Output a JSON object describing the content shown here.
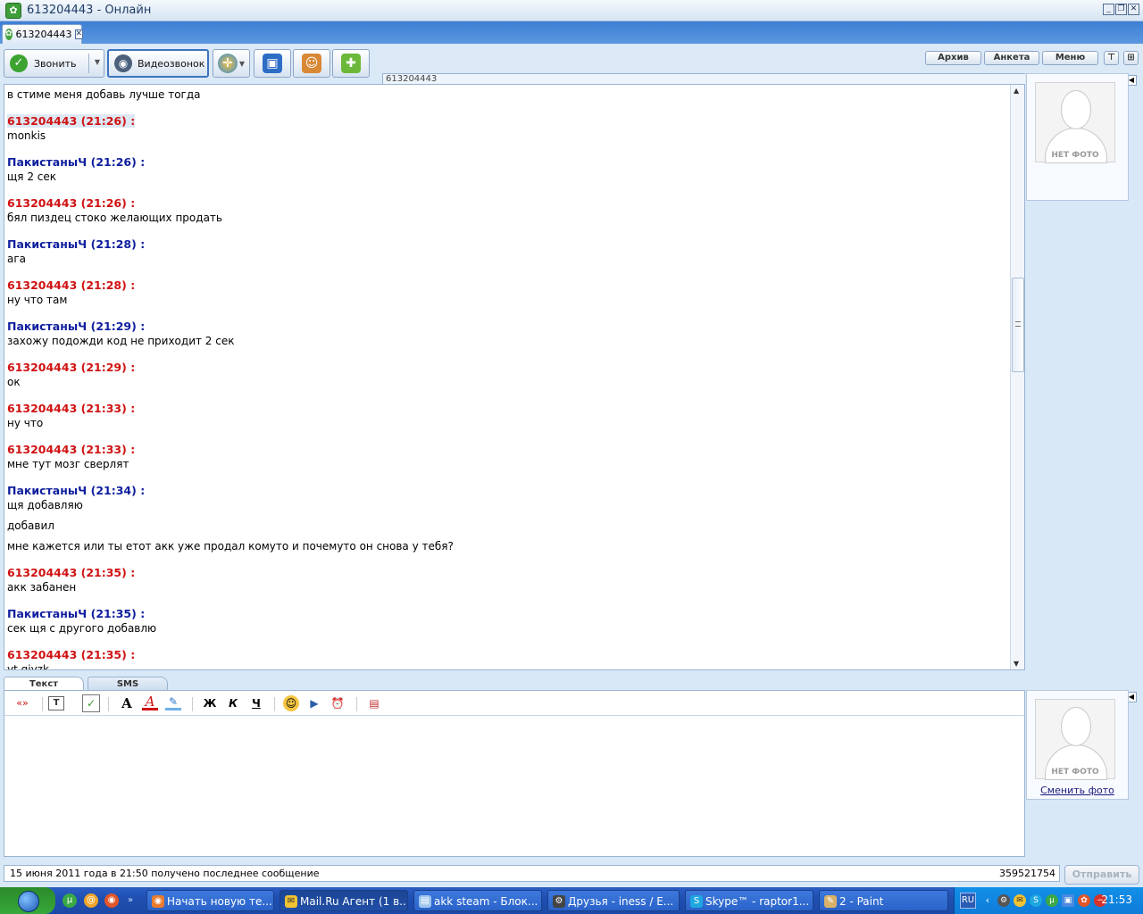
{
  "window": {
    "title": "613204443 - Онлайн"
  },
  "tab": {
    "label": "613204443"
  },
  "toolbar": {
    "call_label": "Звонить",
    "video_label": "Видеозвонок"
  },
  "top_buttons": {
    "archive": "Архив",
    "profile": "Анкета",
    "menu": "Меню"
  },
  "chat": {
    "header": "613204443",
    "first_line": "в стиме меня добавь лучше тогда",
    "messages": [
      {
        "author": "613204443 (21:26) :",
        "who": "me",
        "lines": [
          "monkis"
        ]
      },
      {
        "author": "ПакистаныЧ (21:26) :",
        "who": "other",
        "lines": [
          "щя 2 сек"
        ]
      },
      {
        "author": "613204443 (21:26) :",
        "who": "me",
        "lines": [
          "бял пиздец стоко желающих продать"
        ]
      },
      {
        "author": "ПакистаныЧ (21:28) :",
        "who": "other",
        "lines": [
          "ага"
        ]
      },
      {
        "author": "613204443 (21:28) :",
        "who": "me",
        "lines": [
          "ну что там"
        ]
      },
      {
        "author": "ПакистаныЧ (21:29) :",
        "who": "other",
        "lines": [
          "захожу подожди код не приходит 2 сек"
        ]
      },
      {
        "author": "613204443 (21:29) :",
        "who": "me",
        "lines": [
          "ок"
        ]
      },
      {
        "author": "613204443 (21:33) :",
        "who": "me",
        "lines": [
          "ну что"
        ]
      },
      {
        "author": "613204443 (21:33) :",
        "who": "me",
        "lines": [
          "мне тут мозг сверлят"
        ]
      },
      {
        "author": "ПакистаныЧ (21:34) :",
        "who": "other",
        "lines": [
          "щя добавляю",
          "добавил",
          "мне кажется или ты етот акк уже продал комуто и почемуто он снова у тебя?"
        ]
      },
      {
        "author": "613204443 (21:35) :",
        "who": "me",
        "lines": [
          "акк забанен"
        ]
      },
      {
        "author": "ПакистаныЧ (21:35) :",
        "who": "other",
        "lines": [
          "сек щя с другого добавлю"
        ]
      },
      {
        "author": "613204443 (21:35) :",
        "who": "me",
        "lines": [
          "yt gjyzk"
        ]
      }
    ]
  },
  "right_panel": {
    "no_photo": "НЕТ ФОТО",
    "change_photo": "Сменить фото"
  },
  "composer": {
    "tab_text": "Текст",
    "tab_sms": "SMS",
    "value": ""
  },
  "status": {
    "last_message": "15 июня 2011 года в 21:50 получено последнее сообщение",
    "counter": "359521754"
  },
  "send_button": "Отправить",
  "taskbar": {
    "tasks": [
      "Начать новую те...",
      "Mail.Ru Агент (1 в...",
      "akk steam - Блок...",
      "Друзья - iness / E...",
      "Skype™ - raptor1...",
      "2 - Paint"
    ],
    "lang": "RU",
    "clock": "21:53"
  }
}
